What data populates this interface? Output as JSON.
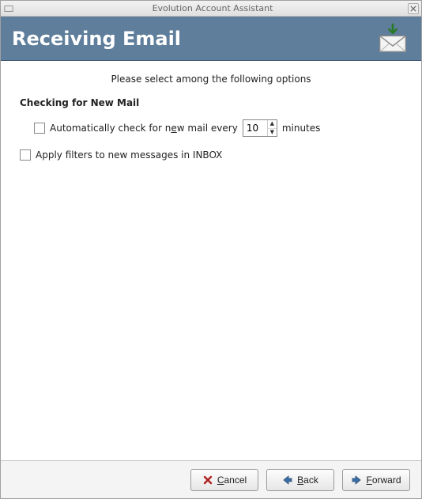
{
  "window": {
    "title": "Evolution Account Assistant"
  },
  "header": {
    "title": "Receiving Email"
  },
  "content": {
    "intro": "Please select among the following options",
    "section_title": "Checking for New Mail",
    "auto_check": {
      "prefix": "Automatically check for n",
      "underlined": "e",
      "suffix": "w mail every",
      "value": "10",
      "unit": "minutes",
      "checked": false
    },
    "apply_filters": {
      "label": "Apply filters to new messages in INBOX",
      "checked": false
    }
  },
  "footer": {
    "cancel_underlined": "C",
    "cancel_rest": "ancel",
    "back_underlined": "B",
    "back_rest": "ack",
    "forward_underlined": "F",
    "forward_rest": "orward"
  }
}
